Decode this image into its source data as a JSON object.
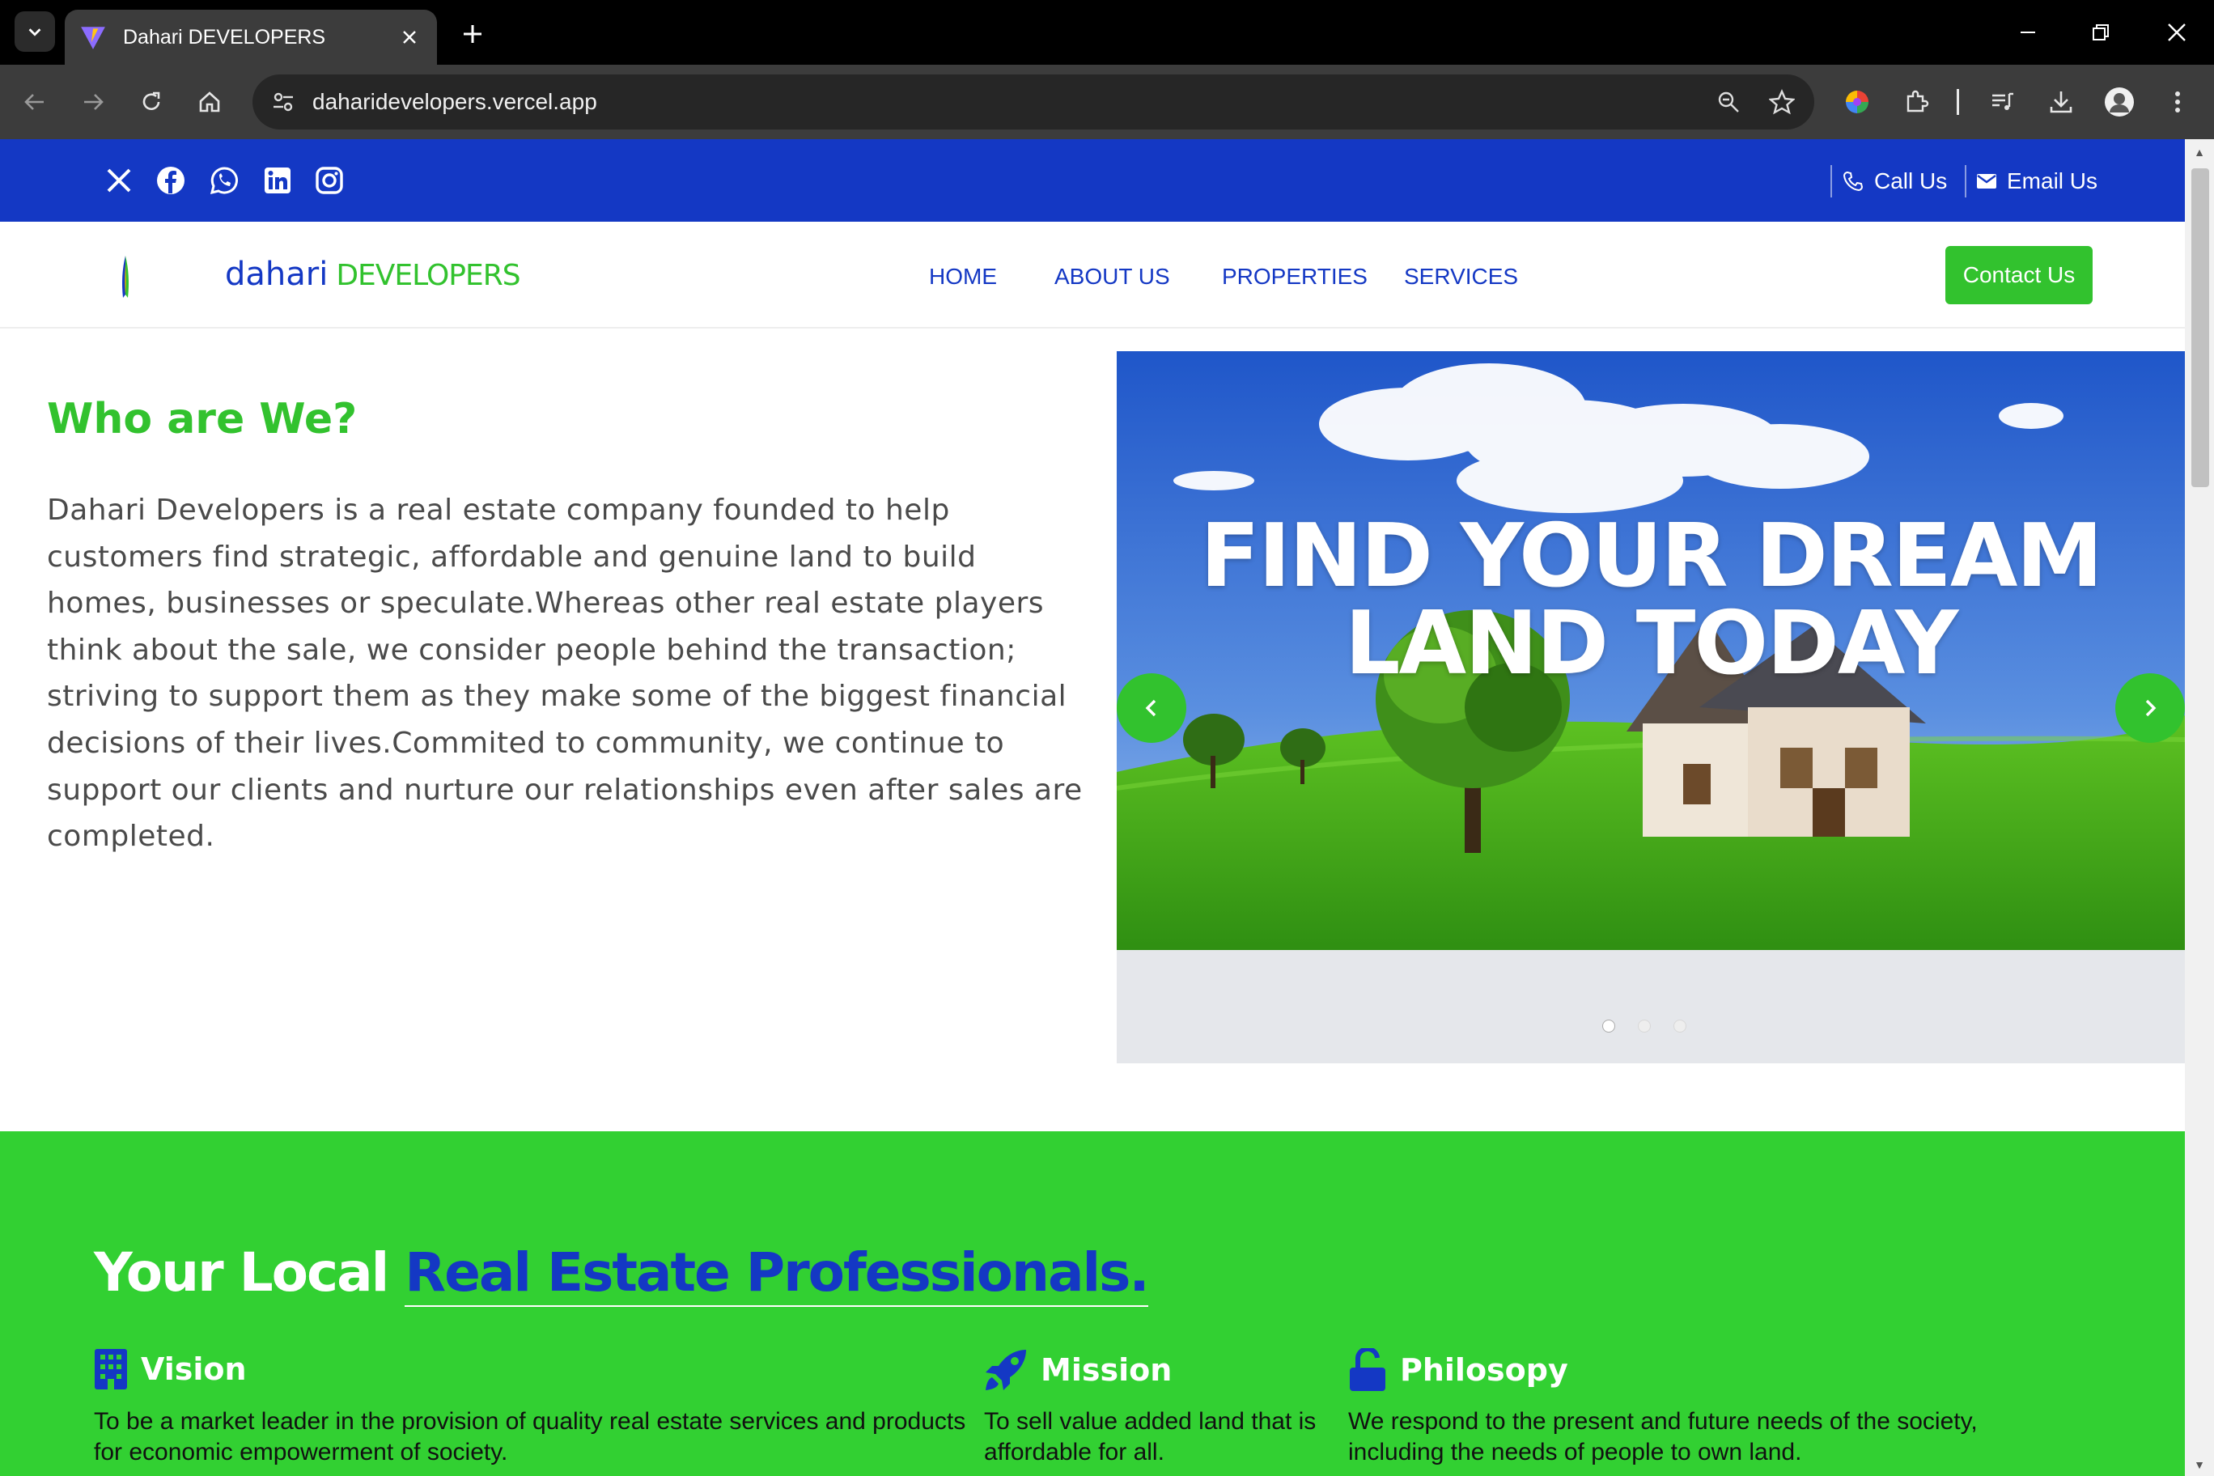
{
  "browser": {
    "tab_title": "Dahari DEVELOPERS",
    "url": "daharidevelopers.vercel.app"
  },
  "topbar": {
    "call_label": "Call Us",
    "email_label": "Email Us",
    "socials": [
      "x-icon",
      "facebook-icon",
      "whatsapp-icon",
      "linkedin-icon",
      "instagram-icon"
    ]
  },
  "nav": {
    "brand_main": "dahari",
    "brand_sub": "DEVELOPERS",
    "items": [
      "HOME",
      "ABOUT US",
      "PROPERTIES",
      "SERVICES"
    ],
    "cta": "Contact Us"
  },
  "about": {
    "title": "Who are We?",
    "text": "Dahari Developers is a real estate company founded to help customers find strategic, affordable and genuine land to build homes, businesses or speculate.Whereas other real estate players think about the sale, we consider people behind the transaction; striving to support them as they make some of the biggest financial decisions of their lives.Commited to community, we continue to support our clients and nurture our relationships even after sales are completed."
  },
  "carousel": {
    "line1": "FIND YOUR DREAM",
    "line2": "LAND TODAY",
    "slides_total": 3,
    "active_slide": 1
  },
  "professionals": {
    "title_prefix": "Your Local",
    "title_accent": "Real Estate Professionals.",
    "features": [
      {
        "heading": "Vision",
        "text": "To be a market leader in the provision of quality real estate services and products for economic empowerment of society."
      },
      {
        "heading": "Mission",
        "text": "To sell value added land that is affordable for all."
      },
      {
        "heading": "Philosopy",
        "text": "We respond to the present and future needs of the society, including the needs of people to own land."
      }
    ]
  },
  "colors": {
    "brand_blue": "#1438c4",
    "brand_green": "#32c22e",
    "section_green": "#32d032"
  }
}
